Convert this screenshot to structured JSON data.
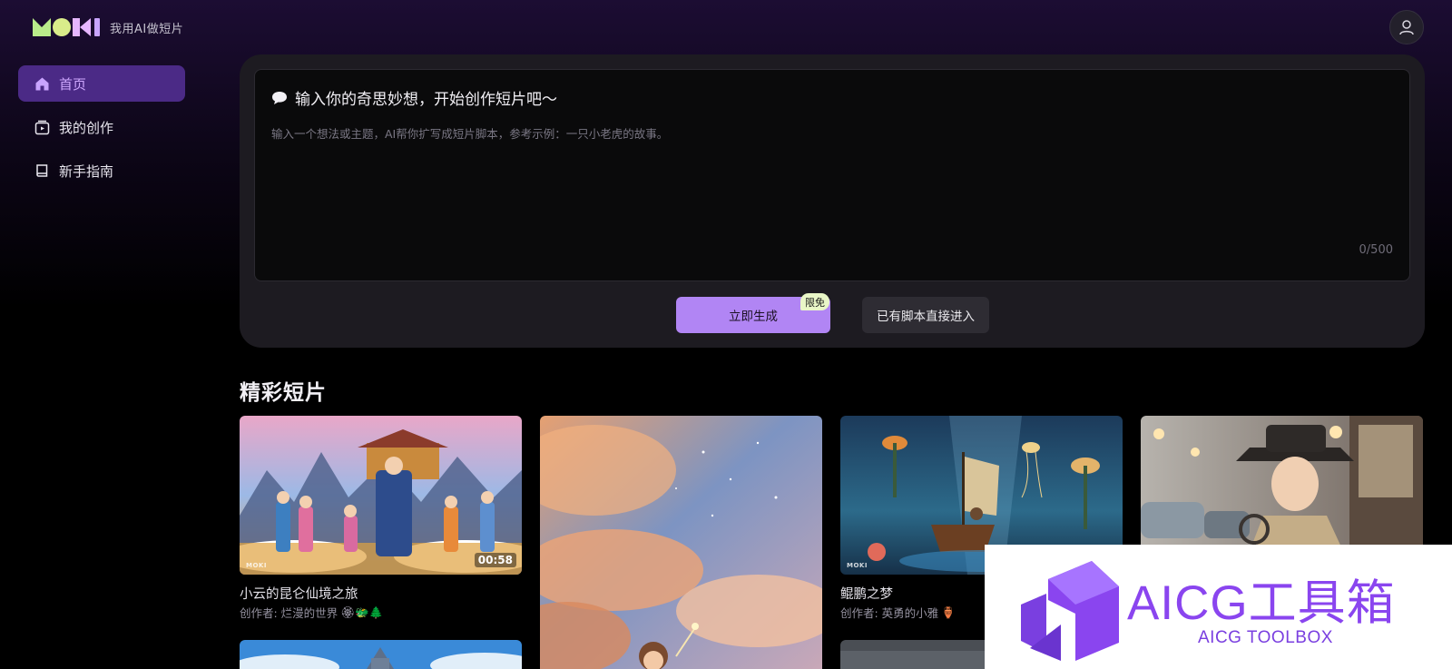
{
  "header": {
    "logo_text": "MOKI",
    "slogan": "我用AI做短片"
  },
  "sidebar": {
    "items": [
      {
        "label": "首页",
        "icon": "home-icon",
        "active": true
      },
      {
        "label": "我的创作",
        "icon": "creation-icon",
        "active": false
      },
      {
        "label": "新手指南",
        "icon": "book-icon",
        "active": false
      }
    ]
  },
  "prompt": {
    "title": "输入你的奇思妙想，开始创作短片吧～",
    "placeholder": "输入一个想法或主题，AI帮你扩写成短片脚本，参考示例：一只小老虎的故事。",
    "char_count": "0/500",
    "generate_label": "立即生成",
    "free_badge": "限免",
    "script_label": "已有脚本直接进入"
  },
  "gallery": {
    "title": "精彩短片",
    "cards": [
      {
        "title": "小云的昆仑仙境之旅",
        "author": "创作者: 烂漫的世界",
        "author_emoji": "🏵🐲🌲",
        "duration": "00:58"
      },
      {
        "title": "",
        "author": "",
        "author_emoji": "",
        "duration": ""
      },
      {
        "title": "鲲鹏之梦",
        "author": "创作者: 英勇的小雅",
        "author_emoji": "🏺",
        "duration": ""
      },
      {
        "title": "",
        "author": "",
        "author_emoji": "",
        "duration": ""
      }
    ]
  },
  "overlay": {
    "title": "AICG工具箱",
    "subtitle": "AICG TOOLBOX"
  },
  "colors": {
    "accent": "#b185f4",
    "active_nav_bg": "#4b2a86",
    "badge_bg": "#e9f6c7",
    "overlay_purple": "#8a45ef"
  }
}
